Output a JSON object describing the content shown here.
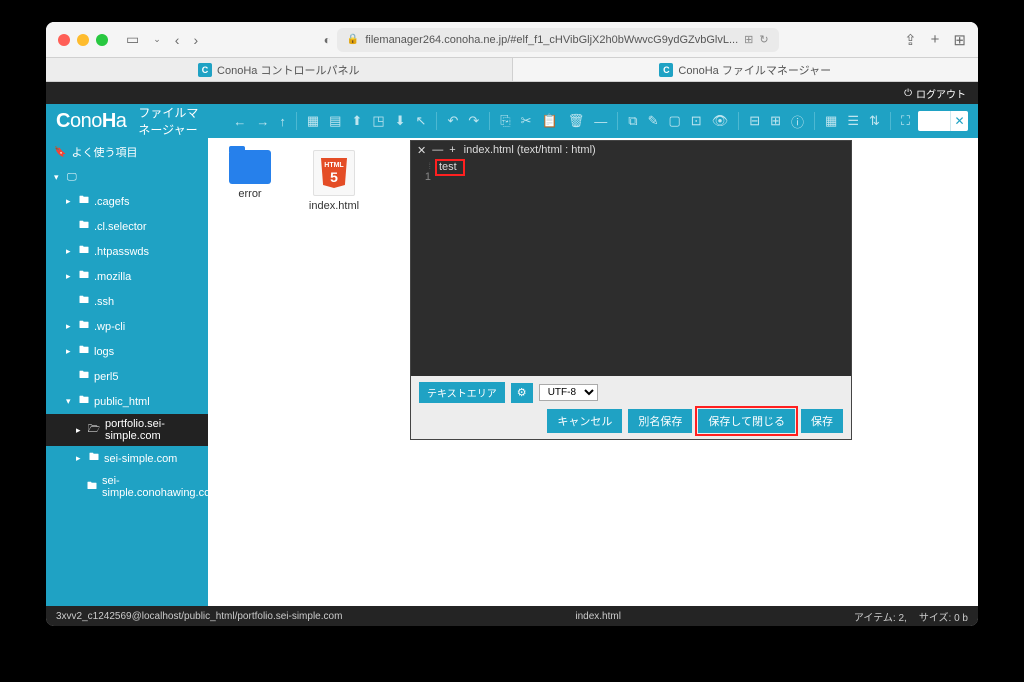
{
  "browser": {
    "url": "filemanager264.conoha.ne.jp/#elf_f1_cHVibGljX2h0bWwvcG9ydGZvbGlvL...",
    "tabs": [
      {
        "label": "ConoHa コントロールパネル"
      },
      {
        "label": "ConoHa ファイルマネージャー"
      }
    ]
  },
  "header": {
    "logout": "ログアウト",
    "logo_brand": "ConoHa",
    "logo_subtitle": "ファイルマネージャー"
  },
  "sidebar": {
    "favorites": "よく使う項目",
    "items": [
      {
        "label": ".cagefs"
      },
      {
        "label": ".cl.selector"
      },
      {
        "label": ".htpasswds"
      },
      {
        "label": ".mozilla"
      },
      {
        "label": ".ssh"
      },
      {
        "label": ".wp-cli"
      },
      {
        "label": "logs"
      },
      {
        "label": "perl5"
      },
      {
        "label": "public_html"
      },
      {
        "label": "portfolio.sei-simple.com"
      },
      {
        "label": "sei-simple.com"
      },
      {
        "label": "sei-simple.conohawing.com"
      }
    ]
  },
  "files": {
    "items": [
      {
        "name": "error",
        "type": "folder"
      },
      {
        "name": "index.html",
        "type": "html"
      }
    ]
  },
  "editor": {
    "title": "index.html (text/html : html)",
    "line_number": "1",
    "content": "test",
    "textarea_label": "テキストエリア",
    "encoding": "UTF-8",
    "buttons": {
      "cancel": "キャンセル",
      "save_as": "別名保存",
      "save_close": "保存して閉じる",
      "save": "保存"
    }
  },
  "statusbar": {
    "path": "3xvv2_c1242569@localhost/public_html/portfolio.sei-simple.com",
    "file": "index.html",
    "items_label": "アイテム: 2,",
    "size_label": "サイズ: 0 b"
  },
  "html5_label": "HTML"
}
